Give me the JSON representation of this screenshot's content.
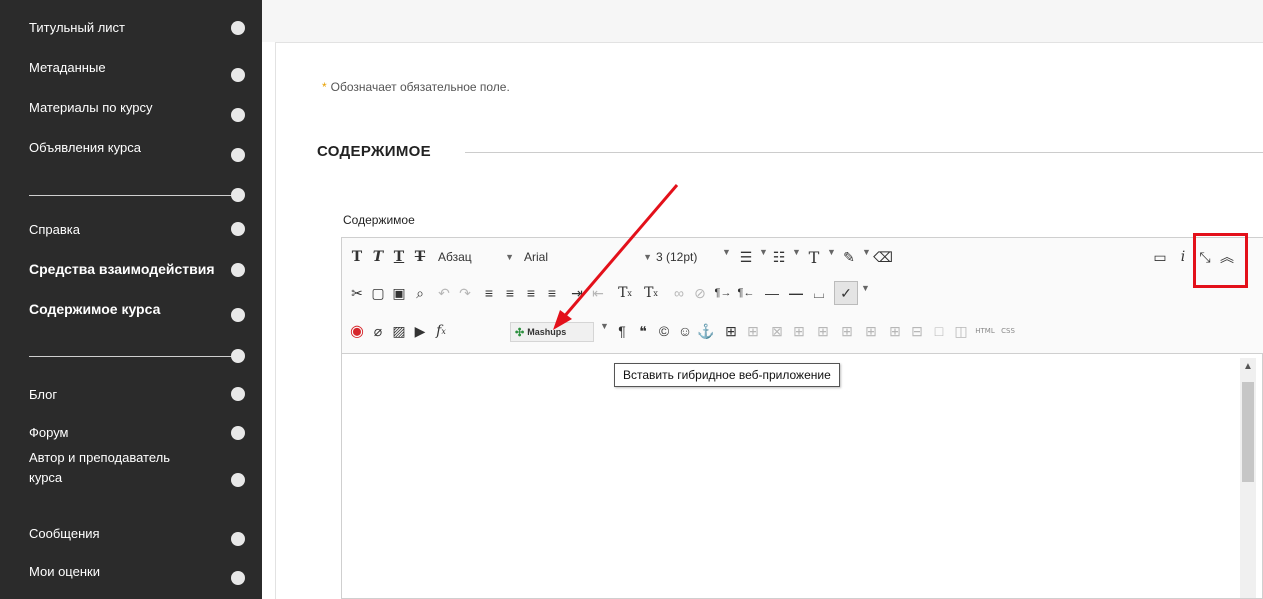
{
  "sidebar": {
    "items": [
      {
        "label": "Титульный лист",
        "bold": false
      },
      {
        "label": "Метаданные",
        "bold": false
      },
      {
        "label": "Материалы по курсу",
        "bold": false
      },
      {
        "label": "Объявления курса",
        "bold": false
      },
      {
        "label": "Справка",
        "bold": false
      },
      {
        "label": "Средства взаимодействия",
        "bold": true
      },
      {
        "label": "Содержимое курса",
        "bold": true
      },
      {
        "label": "Блог",
        "bold": false
      },
      {
        "label": "Форум",
        "bold": false
      },
      {
        "label": "Автор и преподаватель курса",
        "bold": false
      },
      {
        "label": "Сообщения",
        "bold": false
      },
      {
        "label": "Мои оценки",
        "bold": false
      }
    ]
  },
  "form": {
    "required_star": "*",
    "required_note": "Обозначает обязательное поле.",
    "section_title": "СОДЕРЖИМОЕ",
    "editor_label": "Содержимое"
  },
  "toolbar": {
    "paragraph_select": "Абзац",
    "font_select": "Arial",
    "size_select": "3 (12pt)",
    "mashups_label": "Mashups",
    "tooltip": "Вставить гибридное веб-приложение",
    "html_label": "HTML",
    "css_label": "CSS"
  },
  "colors": {
    "sidebar_bg": "#2b2b2b",
    "highlight": "#e3101a",
    "required_star": "#e8a000"
  }
}
